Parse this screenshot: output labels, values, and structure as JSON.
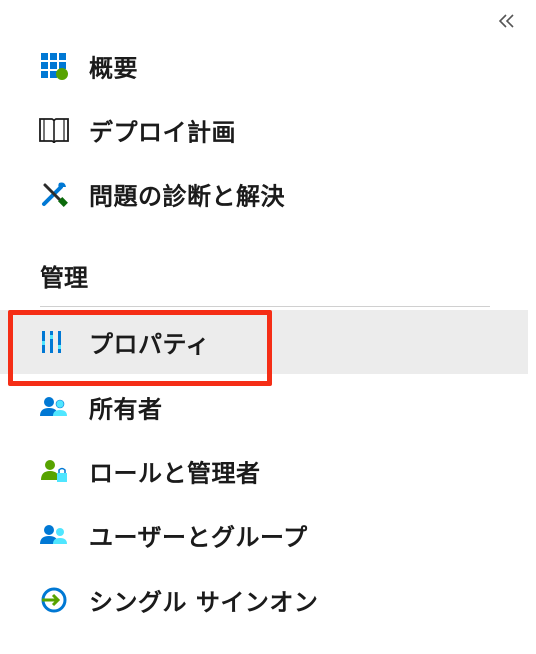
{
  "nav": {
    "collapse_icon": "double-chevron-left-icon",
    "items": [
      {
        "label": "概要",
        "icon": "overview-grid-icon"
      },
      {
        "label": "デプロイ計画",
        "icon": "book-icon"
      },
      {
        "label": "問題の診断と解決",
        "icon": "wrench-screwdriver-icon"
      }
    ],
    "section": {
      "title": "管理",
      "items": [
        {
          "label": "プロパティ",
          "icon": "properties-bars-icon",
          "selected": true
        },
        {
          "label": "所有者",
          "icon": "owners-people-icon"
        },
        {
          "label": "ロールと管理者",
          "icon": "role-admin-icon"
        },
        {
          "label": "ユーザーとグループ",
          "icon": "users-groups-icon"
        },
        {
          "label": "シングル サインオン",
          "icon": "single-sign-on-icon"
        }
      ]
    }
  },
  "colors": {
    "highlight": "#f52e16",
    "selected_bg": "#ececec",
    "azure_blue": "#0078d4",
    "green": "#57a300"
  }
}
